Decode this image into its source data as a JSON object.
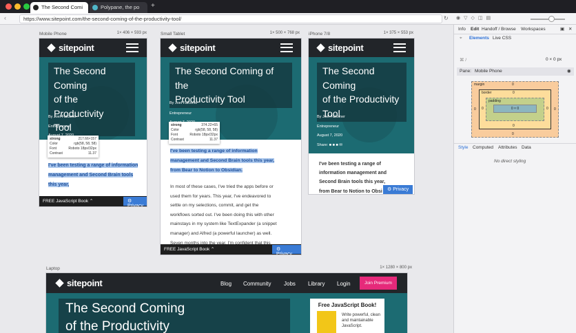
{
  "browser": {
    "tabs": [
      {
        "label": "The Second Comi"
      },
      {
        "label": "Polypane, the po"
      }
    ],
    "new_tab": "+",
    "url": "https://www.sitepoint.com/the-second-coming-of-the-productivity-tool/"
  },
  "panes": [
    {
      "name": "Mobile Phone",
      "size": "1×  406 × 593 px"
    },
    {
      "name": "Small Tablet",
      "size": "1×  500 × 768 px"
    },
    {
      "name": "iPhone 7/8",
      "size": "1×  375 × 553 px"
    },
    {
      "name": "Laptop",
      "size": "1×  1280 × 800 px"
    }
  ],
  "site": {
    "logo": "sitepoint",
    "title": "The Second Coming of the Productivity Tool",
    "title_lines": [
      "The Second Coming",
      "of the Productivity",
      "Tool"
    ],
    "tablet_title_lines": [
      "The Second Coming of the",
      "Productivity Tool"
    ],
    "byline": "By Joel Falconer",
    "role": "Entrepreneur",
    "date": "August 7, 2020",
    "share": "Share:",
    "intro_lines": [
      "I've been testing a range of information",
      "management and Second Brain tools",
      "this year,"
    ],
    "intro_tail": "from Bear to Notion to Obsidian.",
    "tablet_intro_lines": [
      "I've been testing a range of information",
      "management and Second Brain tools this year,",
      "from Bear to Notion to Obsidian."
    ],
    "iphone_intro_lines": [
      "I've been testing a range of",
      "information management and",
      "Second Brain tools this year,",
      "from Bear to Notion to Obsi"
    ],
    "para_lines": [
      "In most of these cases, I've tried the apps before or",
      "used them for years. This year, I've endeavored to",
      "settle on my selections, commit, and get the",
      "workflows sorted out. I've been doing this with other",
      "mainstays in my system like TextExpander (a snippet",
      "manager) and Alfred (a powerful launcher) as well.",
      "Seven months into the year, I'm confident that this"
    ],
    "privacy": "Privacy",
    "js_book": "FREE JavaScript Book",
    "nav": [
      "Blog",
      "Community",
      "Jobs",
      "Library",
      "Login"
    ],
    "premium": "Join Premium",
    "sidebar_title": "Free JavaScript Book!",
    "sidebar_text": [
      "Write powerful, clean",
      "and maintainable",
      "JavaScript."
    ]
  },
  "tooltip": {
    "tag": "strong",
    "size": "217.66×157",
    "color_label": "Color",
    "color": "rgb(58, 58, 58)",
    "font_label": "Font",
    "font": "Roboto 18px/32px",
    "contrast_label": "Contrast",
    "contrast": "11.37",
    "tablet_size": "374.22×65"
  },
  "devtools": {
    "top_tabs": [
      "Info",
      "Edit",
      "Handoff / Browse",
      "Workspaces"
    ],
    "sub_tabs": [
      "Elements",
      "Live CSS"
    ],
    "pane_label": "Pane:",
    "pane_value": "Mobile Phone",
    "dims": "0 × 0 px",
    "box": {
      "margin": "margin",
      "border": "border",
      "padding": "padding",
      "content": "0 × 0",
      "zero": "0"
    },
    "style_tabs": [
      "Style",
      "Computed",
      "Attributes",
      "Data"
    ],
    "no_styling": "No direct styling"
  },
  "colors": {
    "teal": "#1c6b72",
    "dark": "#222529",
    "premium": "#e6297a",
    "privacy": "#3a7bd5",
    "highlight": "#a9c6ec"
  }
}
